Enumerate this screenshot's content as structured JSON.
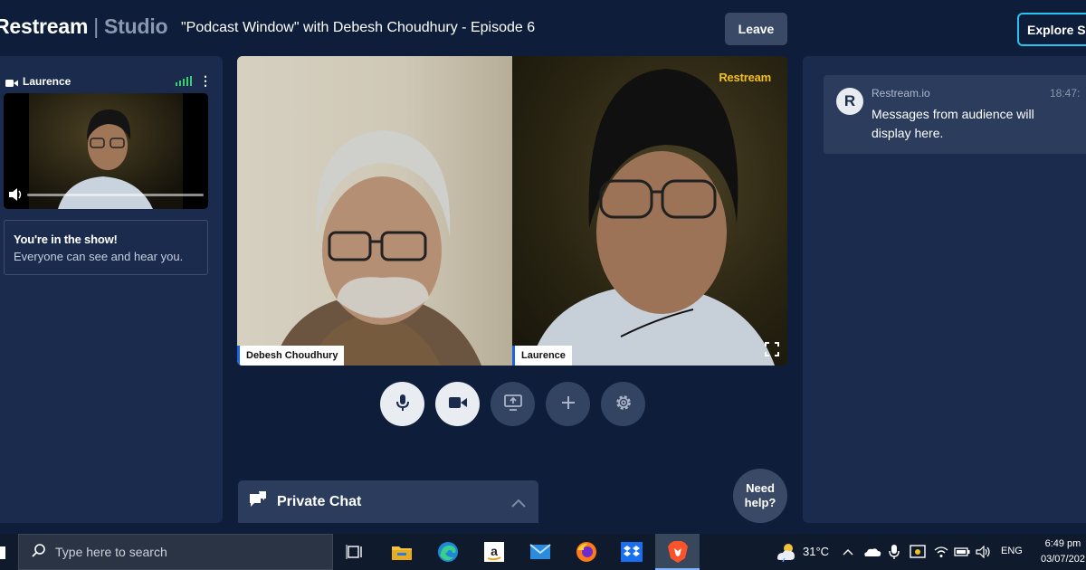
{
  "header": {
    "brand": "Restream",
    "brand_separator": "|",
    "brand_product": "Studio",
    "show_title": "\"Podcast Window\" with Debesh Choudhury - Episode 6",
    "leave_label": "Leave",
    "explore_label": "Explore S"
  },
  "left_panel": {
    "self_name": "Laurence",
    "notice_title": "You're in the show!",
    "notice_text": "Everyone can see and hear you."
  },
  "stage": {
    "guest_1_name": "Debesh Choudhury",
    "guest_2_name": "Laurence",
    "watermark": "Restream"
  },
  "controls": {
    "mic_icon": "microphone-icon",
    "camera_icon": "camera-icon",
    "share_icon": "screen-share-icon",
    "add_icon": "plus-icon",
    "settings_icon": "gear-icon"
  },
  "private_chat": {
    "label": "Private Chat"
  },
  "need_help": {
    "line1": "Need",
    "line2": "help?"
  },
  "chat": {
    "avatar_letter": "R",
    "author": "Restream.io",
    "time": "18:47:",
    "text": "Messages from audience will display here."
  },
  "taskbar": {
    "search_placeholder": "Type here to search",
    "temperature": "31°C",
    "language": "ENG",
    "time": "6:49 pm",
    "date": "03/07/202"
  },
  "colors": {
    "background": "#0d1d3a",
    "panel": "#1a2b4d",
    "accent": "#28c3f0",
    "signal": "#37d06b"
  }
}
